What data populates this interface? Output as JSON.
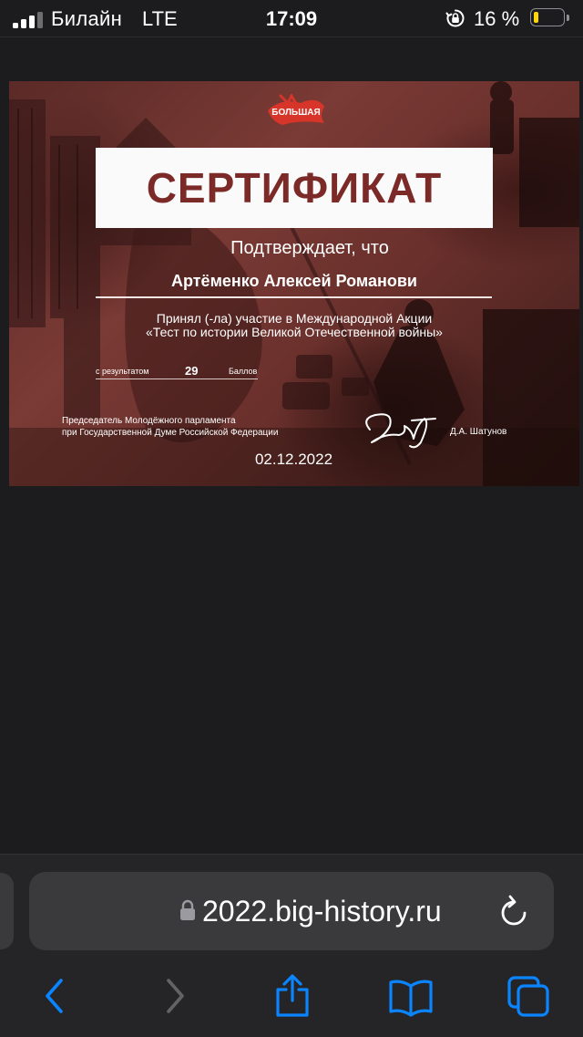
{
  "status_bar": {
    "carrier": "Билайн",
    "network": "LTE",
    "time": "17:09",
    "battery_percent": "16 %",
    "battery_level": 0.16,
    "icons": [
      "signal-icon",
      "rotation-lock-icon",
      "battery-icon"
    ],
    "colors": {
      "battery_fill": "#ffd60a"
    }
  },
  "certificate": {
    "brand": "БОЛЬШАЯ",
    "title": "СЕРТИФИКАТ",
    "confirms": "Подтверждает, что",
    "recipient": "Артёменко Алексей Романови",
    "participation_line1": "Принял (-ла) участие в Международной Акции",
    "participation_line2": "«Тест по истории Великой Отечественной войны»",
    "result_label": "с результатом",
    "result_value": "29",
    "result_unit": "Баллов",
    "chair_line1": "Председатель Молодёжного парламента",
    "chair_line2": "при Государственной Думе Российской Федерации",
    "signatory": "Д.А. Шатунов",
    "date": "02.12.2022",
    "colors": {
      "title_text": "#7b2a27",
      "brand_red": "#d8352a"
    }
  },
  "browser": {
    "url": "2022.big-history.ru",
    "icons": {
      "lock": "lock-icon",
      "reload": "reload-icon",
      "back": "back-icon",
      "forward": "forward-icon",
      "share": "share-icon",
      "bookmarks": "bookmarks-icon",
      "tabs": "tabs-icon"
    },
    "colors": {
      "accent": "#0a84ff",
      "disabled": "#636366"
    }
  }
}
